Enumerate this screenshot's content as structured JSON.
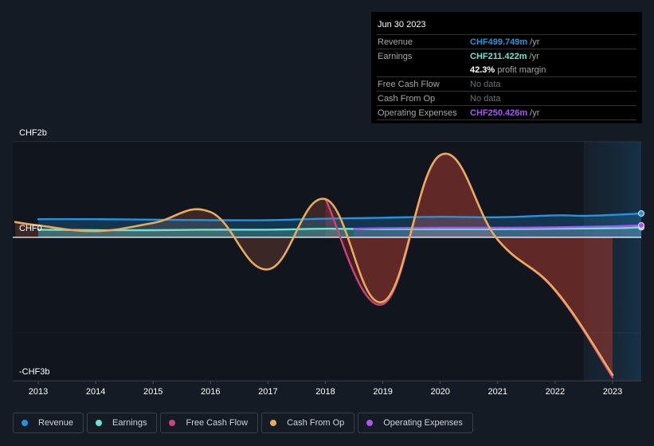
{
  "tooltip": {
    "date": "Jun 30 2023",
    "rows": [
      {
        "label": "Revenue",
        "value": "CHF499.749m",
        "unit": "/yr",
        "color": "#2394df"
      },
      {
        "label": "Earnings",
        "value": "CHF211.422m",
        "unit": "/yr",
        "color": "#6ce5d0"
      },
      {
        "label": "",
        "value": "42.3%",
        "unit": "profit margin",
        "color": "#ffffff"
      },
      {
        "label": "Free Cash Flow",
        "value": "No data",
        "unit": "",
        "color": "#6b6f76"
      },
      {
        "label": "Cash From Op",
        "value": "No data",
        "unit": "",
        "color": "#6b6f76"
      },
      {
        "label": "Operating Expenses",
        "value": "CHF250.426m",
        "unit": "/yr",
        "color": "#a855f7"
      }
    ]
  },
  "legend": [
    {
      "label": "Revenue",
      "color": "#2394df"
    },
    {
      "label": "Earnings",
      "color": "#6ce5d0"
    },
    {
      "label": "Free Cash Flow",
      "color": "#c9467d"
    },
    {
      "label": "Cash From Op",
      "color": "#e8aa5b"
    },
    {
      "label": "Operating Expenses",
      "color": "#a855f7"
    }
  ],
  "chart_data": {
    "type": "line",
    "title": "",
    "xlabel": "",
    "ylabel": "",
    "currency": "CHF",
    "units": "billions",
    "ylim": [
      -3,
      2
    ],
    "xlim": [
      2012.6,
      2023.5
    ],
    "y_tick_labels": [
      {
        "value": 2,
        "label": "CHF2b"
      },
      {
        "value": 0,
        "label": "CHF0"
      },
      {
        "value": -3,
        "label": "-CHF3b"
      }
    ],
    "y_gridlines": [
      2,
      0,
      -2,
      -3
    ],
    "x_ticks": [
      2013,
      2014,
      2015,
      2016,
      2017,
      2018,
      2019,
      2020,
      2021,
      2022,
      2023
    ],
    "forecast_region_start": 2022.5,
    "grid": true,
    "legend_position": "bottom",
    "series": [
      {
        "name": "Revenue",
        "color": "#2394df",
        "fill": true,
        "x": [
          2013,
          2014,
          2015,
          2016,
          2017,
          2018,
          2019,
          2020,
          2021,
          2022,
          2022.5,
          2023,
          2023.5
        ],
        "y": [
          0.38,
          0.38,
          0.37,
          0.36,
          0.36,
          0.39,
          0.41,
          0.43,
          0.42,
          0.46,
          0.45,
          0.47,
          0.5
        ]
      },
      {
        "name": "Earnings",
        "color": "#6ce5d0",
        "fill": true,
        "x": [
          2013,
          2014,
          2015,
          2016,
          2017,
          2018,
          2019,
          2020,
          2021,
          2022,
          2023,
          2023.5
        ],
        "y": [
          0.16,
          0.15,
          0.15,
          0.16,
          0.16,
          0.18,
          0.17,
          0.17,
          0.17,
          0.18,
          0.19,
          0.21
        ]
      },
      {
        "name": "Free Cash Flow",
        "color": "#c9467d",
        "fill": true,
        "x": [
          2018,
          2019,
          2020,
          2021,
          2022,
          2023
        ],
        "y": [
          0.8,
          -1.4,
          1.72,
          -0.05,
          -1.12,
          -2.93
        ]
      },
      {
        "name": "Cash From Op",
        "color": "#e8aa5b",
        "fill": true,
        "x": [
          2012.6,
          2013,
          2014,
          2015,
          2016,
          2017,
          2018,
          2019,
          2020,
          2021,
          2022,
          2023
        ],
        "y": [
          0.32,
          0.25,
          0.13,
          0.3,
          0.53,
          -0.67,
          0.8,
          -1.35,
          1.72,
          -0.05,
          -1.1,
          -2.88
        ]
      },
      {
        "name": "Operating Expenses",
        "color": "#a855f7",
        "fill": true,
        "x": [
          2018.5,
          2019,
          2020,
          2021,
          2022,
          2023,
          2023.5
        ],
        "y": [
          0.18,
          0.19,
          0.2,
          0.2,
          0.21,
          0.23,
          0.25
        ]
      }
    ]
  }
}
